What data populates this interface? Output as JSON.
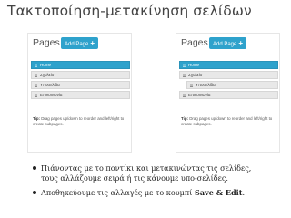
{
  "title": "Τακτοποίηση-μετακίνηση σελίδων",
  "panels": {
    "left": {
      "pages_label": "Pages",
      "add_button": "Add Page",
      "add_icon": "+",
      "items": [
        "Home",
        "Σχολείο",
        "Υποσελίδα",
        "Επικοινωνία"
      ],
      "tip_label": "Tip:",
      "tip_text": "Drag pages up/down to reorder and left/right to create subpages."
    },
    "right": {
      "pages_label": "Pages",
      "add_button": "Add Page",
      "add_icon": "+",
      "items": [
        "Home",
        "Σχολείο",
        "Υποσελίδα",
        "Επικοινωνία"
      ],
      "tip_label": "Tip:",
      "tip_text": "Drag pages up/down to reorder and left/right to create subpages."
    }
  },
  "bullets": {
    "first_line1": "Πιάνοντας με το ποντίκι και μετακινώντας τις σελίδες,",
    "first_line2": "τους αλλάζουμε σειρά ή τις κάνουμε υπο-σελίδες.",
    "second_text": "Αποθηκεύουμε τις αλλαγές με το κουμπί",
    "second_strong": "Save & Edit",
    "second_end": "."
  },
  "colors": {
    "accent": "#2ea2cc",
    "item_bg": "#e8e8e8",
    "title": "#444444"
  }
}
